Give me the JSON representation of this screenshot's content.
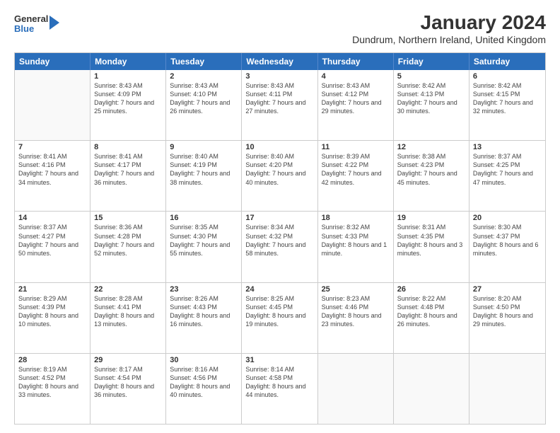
{
  "logo": {
    "general": "General",
    "blue": "Blue"
  },
  "title": "January 2024",
  "subtitle": "Dundrum, Northern Ireland, United Kingdom",
  "days": [
    "Sunday",
    "Monday",
    "Tuesday",
    "Wednesday",
    "Thursday",
    "Friday",
    "Saturday"
  ],
  "rows": [
    [
      {
        "day": "",
        "empty": true
      },
      {
        "day": "1",
        "sunrise": "Sunrise: 8:43 AM",
        "sunset": "Sunset: 4:09 PM",
        "daylight": "Daylight: 7 hours and 25 minutes."
      },
      {
        "day": "2",
        "sunrise": "Sunrise: 8:43 AM",
        "sunset": "Sunset: 4:10 PM",
        "daylight": "Daylight: 7 hours and 26 minutes."
      },
      {
        "day": "3",
        "sunrise": "Sunrise: 8:43 AM",
        "sunset": "Sunset: 4:11 PM",
        "daylight": "Daylight: 7 hours and 27 minutes."
      },
      {
        "day": "4",
        "sunrise": "Sunrise: 8:43 AM",
        "sunset": "Sunset: 4:12 PM",
        "daylight": "Daylight: 7 hours and 29 minutes."
      },
      {
        "day": "5",
        "sunrise": "Sunrise: 8:42 AM",
        "sunset": "Sunset: 4:13 PM",
        "daylight": "Daylight: 7 hours and 30 minutes."
      },
      {
        "day": "6",
        "sunrise": "Sunrise: 8:42 AM",
        "sunset": "Sunset: 4:15 PM",
        "daylight": "Daylight: 7 hours and 32 minutes."
      }
    ],
    [
      {
        "day": "7",
        "sunrise": "Sunrise: 8:41 AM",
        "sunset": "Sunset: 4:16 PM",
        "daylight": "Daylight: 7 hours and 34 minutes."
      },
      {
        "day": "8",
        "sunrise": "Sunrise: 8:41 AM",
        "sunset": "Sunset: 4:17 PM",
        "daylight": "Daylight: 7 hours and 36 minutes."
      },
      {
        "day": "9",
        "sunrise": "Sunrise: 8:40 AM",
        "sunset": "Sunset: 4:19 PM",
        "daylight": "Daylight: 7 hours and 38 minutes."
      },
      {
        "day": "10",
        "sunrise": "Sunrise: 8:40 AM",
        "sunset": "Sunset: 4:20 PM",
        "daylight": "Daylight: 7 hours and 40 minutes."
      },
      {
        "day": "11",
        "sunrise": "Sunrise: 8:39 AM",
        "sunset": "Sunset: 4:22 PM",
        "daylight": "Daylight: 7 hours and 42 minutes."
      },
      {
        "day": "12",
        "sunrise": "Sunrise: 8:38 AM",
        "sunset": "Sunset: 4:23 PM",
        "daylight": "Daylight: 7 hours and 45 minutes."
      },
      {
        "day": "13",
        "sunrise": "Sunrise: 8:37 AM",
        "sunset": "Sunset: 4:25 PM",
        "daylight": "Daylight: 7 hours and 47 minutes."
      }
    ],
    [
      {
        "day": "14",
        "sunrise": "Sunrise: 8:37 AM",
        "sunset": "Sunset: 4:27 PM",
        "daylight": "Daylight: 7 hours and 50 minutes."
      },
      {
        "day": "15",
        "sunrise": "Sunrise: 8:36 AM",
        "sunset": "Sunset: 4:28 PM",
        "daylight": "Daylight: 7 hours and 52 minutes."
      },
      {
        "day": "16",
        "sunrise": "Sunrise: 8:35 AM",
        "sunset": "Sunset: 4:30 PM",
        "daylight": "Daylight: 7 hours and 55 minutes."
      },
      {
        "day": "17",
        "sunrise": "Sunrise: 8:34 AM",
        "sunset": "Sunset: 4:32 PM",
        "daylight": "Daylight: 7 hours and 58 minutes."
      },
      {
        "day": "18",
        "sunrise": "Sunrise: 8:32 AM",
        "sunset": "Sunset: 4:33 PM",
        "daylight": "Daylight: 8 hours and 1 minute."
      },
      {
        "day": "19",
        "sunrise": "Sunrise: 8:31 AM",
        "sunset": "Sunset: 4:35 PM",
        "daylight": "Daylight: 8 hours and 3 minutes."
      },
      {
        "day": "20",
        "sunrise": "Sunrise: 8:30 AM",
        "sunset": "Sunset: 4:37 PM",
        "daylight": "Daylight: 8 hours and 6 minutes."
      }
    ],
    [
      {
        "day": "21",
        "sunrise": "Sunrise: 8:29 AM",
        "sunset": "Sunset: 4:39 PM",
        "daylight": "Daylight: 8 hours and 10 minutes."
      },
      {
        "day": "22",
        "sunrise": "Sunrise: 8:28 AM",
        "sunset": "Sunset: 4:41 PM",
        "daylight": "Daylight: 8 hours and 13 minutes."
      },
      {
        "day": "23",
        "sunrise": "Sunrise: 8:26 AM",
        "sunset": "Sunset: 4:43 PM",
        "daylight": "Daylight: 8 hours and 16 minutes."
      },
      {
        "day": "24",
        "sunrise": "Sunrise: 8:25 AM",
        "sunset": "Sunset: 4:45 PM",
        "daylight": "Daylight: 8 hours and 19 minutes."
      },
      {
        "day": "25",
        "sunrise": "Sunrise: 8:23 AM",
        "sunset": "Sunset: 4:46 PM",
        "daylight": "Daylight: 8 hours and 23 minutes."
      },
      {
        "day": "26",
        "sunrise": "Sunrise: 8:22 AM",
        "sunset": "Sunset: 4:48 PM",
        "daylight": "Daylight: 8 hours and 26 minutes."
      },
      {
        "day": "27",
        "sunrise": "Sunrise: 8:20 AM",
        "sunset": "Sunset: 4:50 PM",
        "daylight": "Daylight: 8 hours and 29 minutes."
      }
    ],
    [
      {
        "day": "28",
        "sunrise": "Sunrise: 8:19 AM",
        "sunset": "Sunset: 4:52 PM",
        "daylight": "Daylight: 8 hours and 33 minutes."
      },
      {
        "day": "29",
        "sunrise": "Sunrise: 8:17 AM",
        "sunset": "Sunset: 4:54 PM",
        "daylight": "Daylight: 8 hours and 36 minutes."
      },
      {
        "day": "30",
        "sunrise": "Sunrise: 8:16 AM",
        "sunset": "Sunset: 4:56 PM",
        "daylight": "Daylight: 8 hours and 40 minutes."
      },
      {
        "day": "31",
        "sunrise": "Sunrise: 8:14 AM",
        "sunset": "Sunset: 4:58 PM",
        "daylight": "Daylight: 8 hours and 44 minutes."
      },
      {
        "day": "",
        "empty": true
      },
      {
        "day": "",
        "empty": true
      },
      {
        "day": "",
        "empty": true
      }
    ]
  ]
}
